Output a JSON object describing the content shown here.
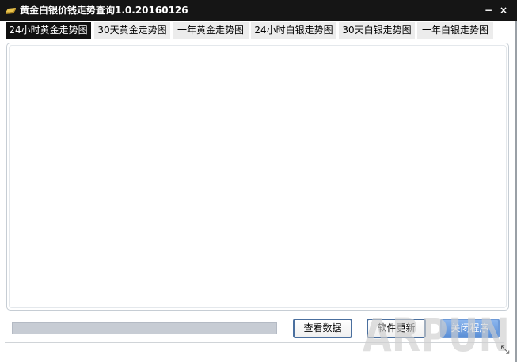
{
  "window": {
    "title": "黄金白银价钱走势查询1.0.20160126",
    "icon": "gold-bar-icon",
    "minimize_glyph": "−",
    "close_glyph": "×"
  },
  "tabs": [
    {
      "label": "24小时黄金走势图",
      "active": true
    },
    {
      "label": "30天黄金走势图",
      "active": false
    },
    {
      "label": "一年黄金走势图",
      "active": false
    },
    {
      "label": "24小时白银走势图",
      "active": false
    },
    {
      "label": "30天白银走势图",
      "active": false
    },
    {
      "label": "一年白银走势图",
      "active": false
    }
  ],
  "progress": {
    "value": 0
  },
  "buttons": {
    "view_data": "查看数据",
    "update_software": "软件更新",
    "close_program": "关闭程序"
  },
  "watermark": {
    "text": "ARPUN"
  },
  "resize_glyph": "⤡",
  "colors": {
    "titlebar": "#151515",
    "active_tab": "#101010",
    "inactive_tab": "#ececec",
    "button_border": "#4a6f9e",
    "close_button": "#5b8fd6",
    "progress_track": "#c7ccd4"
  }
}
